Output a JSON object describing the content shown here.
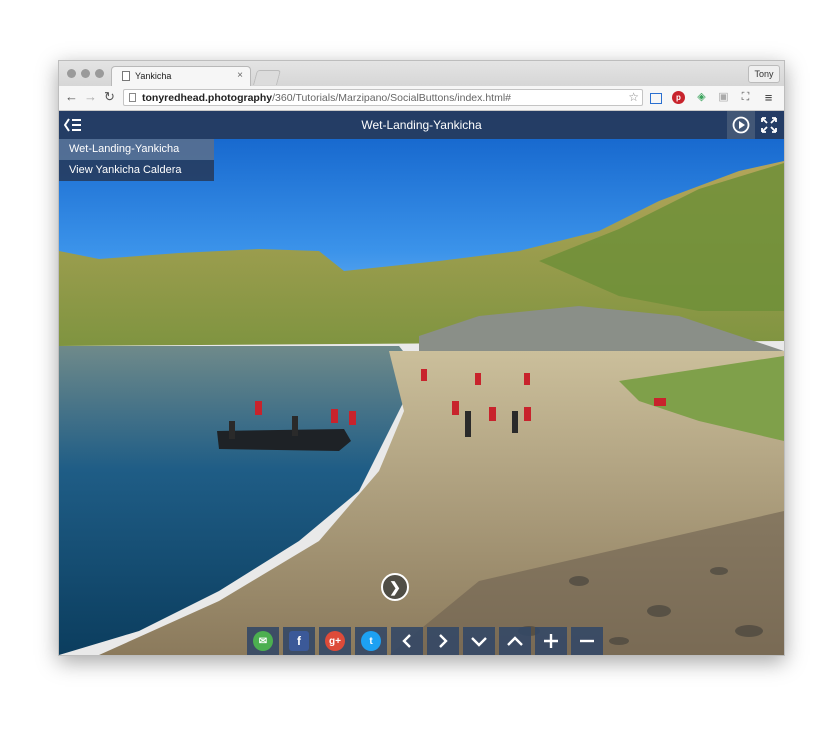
{
  "browser": {
    "tab_title": "Yankicha",
    "tab_close": "×",
    "profile_name": "Tony",
    "url_host": "tonyredhead.photography",
    "url_path": "/360/Tutorials/Marzipano/SocialButtons/index.html#",
    "nav": {
      "back": "←",
      "forward": "→",
      "reload": "↻"
    },
    "bookmark_star": "☆",
    "menu": "≡"
  },
  "viewer": {
    "scene_title": "Wet-Landing-Yankicha",
    "scene_list": [
      {
        "label": "Wet-Landing-Yankicha",
        "active": true
      },
      {
        "label": "View Yankicha Caldera",
        "active": false
      }
    ],
    "hotspot_icon": "chevron-right-icon",
    "share_buttons": [
      {
        "name": "email-share-icon",
        "glyph": "✉",
        "color": "#4caf50"
      },
      {
        "name": "facebook-share-icon",
        "glyph": "f",
        "color": "#3b5998"
      },
      {
        "name": "google-plus-share-icon",
        "glyph": "g+",
        "color": "#dd4b39"
      },
      {
        "name": "twitter-share-icon",
        "glyph": "t",
        "color": "#1da1f2"
      }
    ],
    "controls": [
      {
        "name": "pan-left-icon",
        "glyph": "‹"
      },
      {
        "name": "pan-right-icon",
        "glyph": "›"
      },
      {
        "name": "pan-down-icon",
        "glyph": "⌄"
      },
      {
        "name": "pan-up-icon",
        "glyph": "⌃"
      },
      {
        "name": "zoom-in-icon",
        "glyph": "+"
      },
      {
        "name": "zoom-out-icon",
        "glyph": "−"
      }
    ]
  },
  "colors": {
    "header_bg": "#263a5c",
    "sky": "#1a6fd6",
    "water": "#0d4e78",
    "hills": "#9aa455"
  }
}
